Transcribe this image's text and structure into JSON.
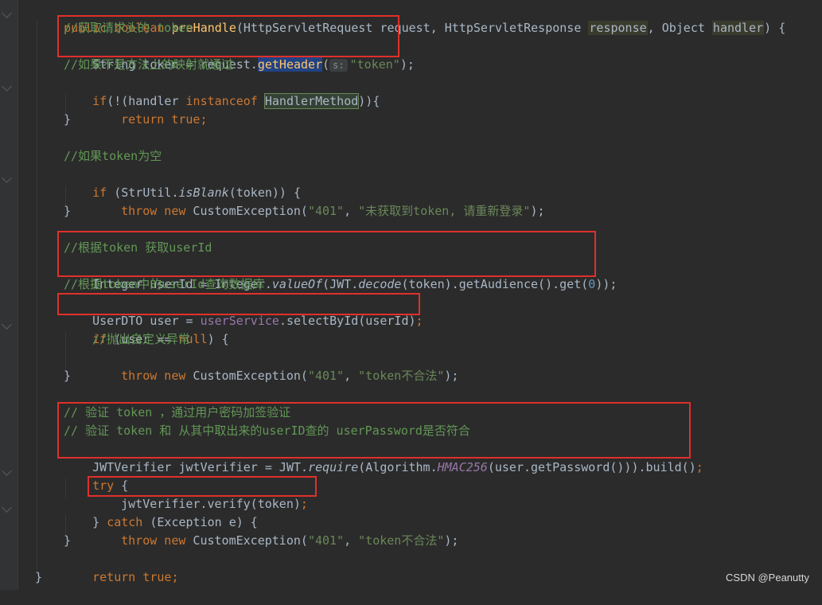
{
  "code_lines": [
    {
      "id": "sig",
      "tokens": [
        "public",
        " boolean",
        " ",
        "preHandle",
        "(HttpServletRequest request, HttpServletResponse ",
        "response",
        ", Object ",
        "handler",
        ") {"
      ]
    },
    {
      "id": "c1",
      "text": "//获取请求头的 token"
    },
    {
      "id": "l2",
      "tokens": [
        "String token = request.",
        "getHeader",
        "(",
        "s:",
        "\"token\"",
        ");"
      ]
    },
    {
      "id": "c3",
      "text": "//如果不是方法上的映射就通过"
    },
    {
      "id": "l4",
      "tokens": [
        "if",
        "(!(handler ",
        "instanceof",
        " ",
        "HandlerMethod",
        "))",
        "{"
      ]
    },
    {
      "id": "l5",
      "tokens": [
        "return",
        " true",
        ";"
      ]
    },
    {
      "id": "l6",
      "text": "}"
    },
    {
      "id": "c8",
      "text": "//如果token为空"
    },
    {
      "id": "l9",
      "tokens": [
        "if",
        " (StrUtil.",
        "isBlank",
        "(token)) {"
      ]
    },
    {
      "id": "l10",
      "tokens": [
        "throw",
        " new",
        " CustomException(",
        "\"401\"",
        ", ",
        "\"未获取到token, 请重新登录\"",
        ");"
      ]
    },
    {
      "id": "l11",
      "text": "}"
    },
    {
      "id": "c13",
      "text": "//根据token 获取userId"
    },
    {
      "id": "l14",
      "tokens": [
        "Integer userId = Integer.",
        "valueOf",
        "(JWT.",
        "decode",
        "(token).getAudience().get(",
        "0",
        "));"
      ]
    },
    {
      "id": "c15",
      "text": "//根据token中的userId查询数据库"
    },
    {
      "id": "l16",
      "tokens": [
        "UserDTO user = ",
        "userService",
        ".selectById(userId)",
        ";"
      ]
    },
    {
      "id": "l17",
      "tokens": [
        "if",
        " (user == ",
        "null",
        ") {"
      ]
    },
    {
      "id": "c18",
      "text": "//抛出自定义异常"
    },
    {
      "id": "l19",
      "tokens": [
        "throw",
        " new",
        " CustomException(",
        "\"401\"",
        ", ",
        "\"token不合法\"",
        ");"
      ]
    },
    {
      "id": "l20",
      "text": "}"
    },
    {
      "id": "c22",
      "text": "// 验证 token ，通过用户密码加签验证"
    },
    {
      "id": "c23",
      "text": "// 验证 token 和 从其中取出来的userID查的 userPassword是否符合"
    },
    {
      "id": "l24",
      "tokens": [
        "JWTVerifier jwtVerifier = JWT.",
        "require",
        "(Algorithm.",
        "HMAC256",
        "(user.getPassword())).build()",
        ";"
      ]
    },
    {
      "id": "l25",
      "tokens": [
        "try",
        " {"
      ]
    },
    {
      "id": "l26",
      "tokens": [
        "jwtVerifier.verify(token)",
        ";"
      ]
    },
    {
      "id": "l27",
      "tokens": [
        "} ",
        "catch",
        " (Exception e) {"
      ]
    },
    {
      "id": "l28",
      "tokens": [
        "throw",
        " new",
        " CustomException(",
        "\"401\"",
        ", ",
        "\"token不合法\"",
        ");"
      ]
    },
    {
      "id": "l29",
      "text": "}"
    },
    {
      "id": "l30",
      "tokens": [
        "return",
        " true",
        ";"
      ]
    },
    {
      "id": "l31",
      "text": "}"
    }
  ],
  "watermark": "CSDN @Peanutty",
  "colors": {
    "background": "#2b2b2b",
    "keyword": "#cc7832",
    "comment": "#629755",
    "string": "#6a8759",
    "highlight_box": "#e0302a"
  }
}
